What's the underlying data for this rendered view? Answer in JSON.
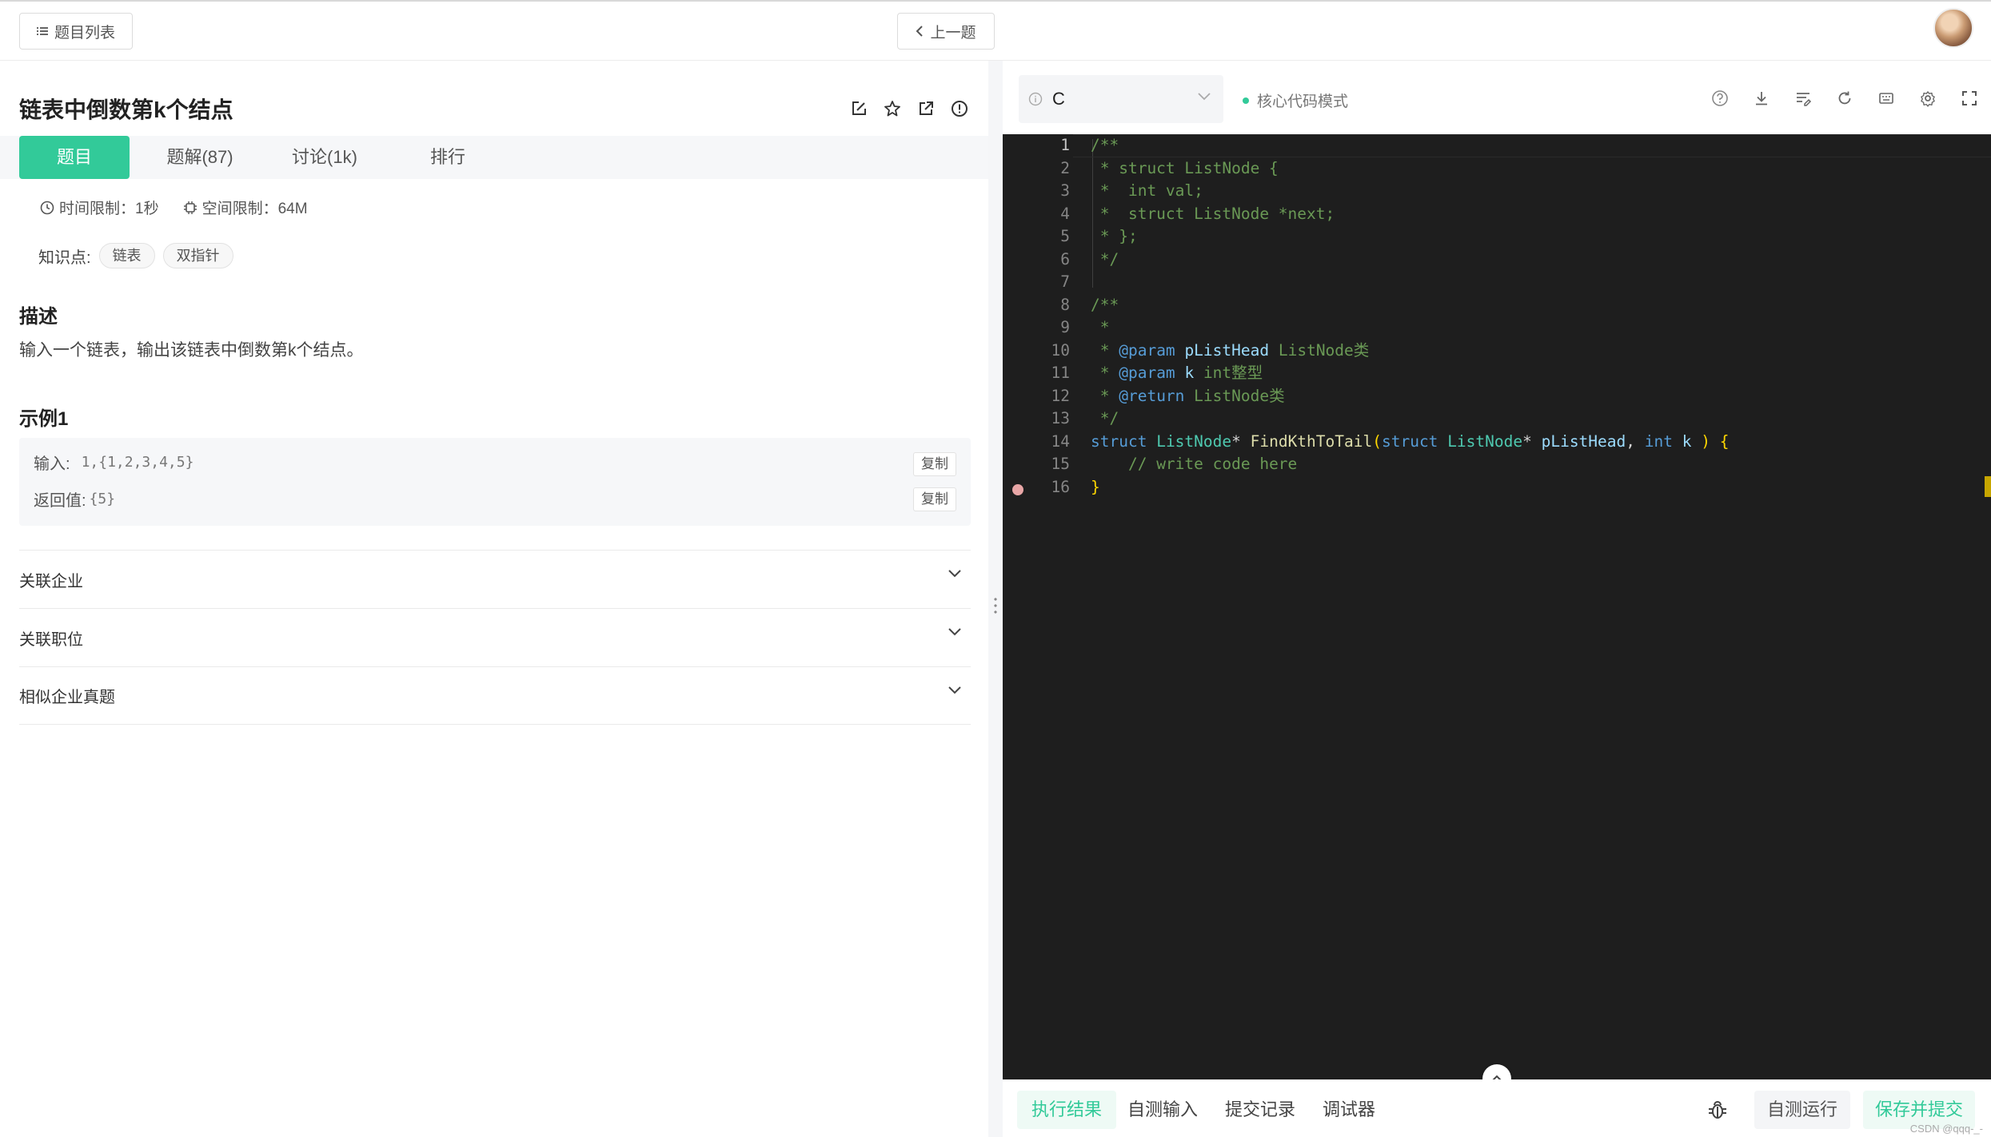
{
  "topbar": {
    "list_button": "题目列表",
    "prev_button": "上一题"
  },
  "problem": {
    "title": "链表中倒数第k个结点",
    "tabs": [
      {
        "label": "题目"
      },
      {
        "label": "题解(87)"
      },
      {
        "label": "讨论(1k)"
      },
      {
        "label": "排行"
      }
    ],
    "time_limit": "时间限制：1秒",
    "space_limit": "空间限制：64M",
    "tags_label": "知识点:",
    "tags": [
      "链表",
      "双指针"
    ],
    "description_heading": "描述",
    "description": "输入一个链表，输出该链表中倒数第k个结点。",
    "example_heading": "示例1",
    "example": {
      "input_label": "输入:",
      "input_value": "1,{1,2,3,4,5}",
      "output_label": "返回值:",
      "output_value": "{5}",
      "copy_label": "复制"
    },
    "accordions": [
      "关联企业",
      "关联职位",
      "相似企业真题"
    ]
  },
  "editor": {
    "language": "C",
    "mode": "核心代码模式",
    "line_numbers": [
      "1",
      "2",
      "3",
      "4",
      "5",
      "6",
      "7",
      "8",
      "9",
      "10",
      "11",
      "12",
      "13",
      "14",
      "15",
      "16"
    ]
  },
  "bottom": {
    "tabs": [
      "执行结果",
      "自测输入",
      "提交记录",
      "调试器"
    ],
    "run_button": "自测运行",
    "submit_button": "保存并提交"
  },
  "watermark": "CSDN @qqq-_-"
}
